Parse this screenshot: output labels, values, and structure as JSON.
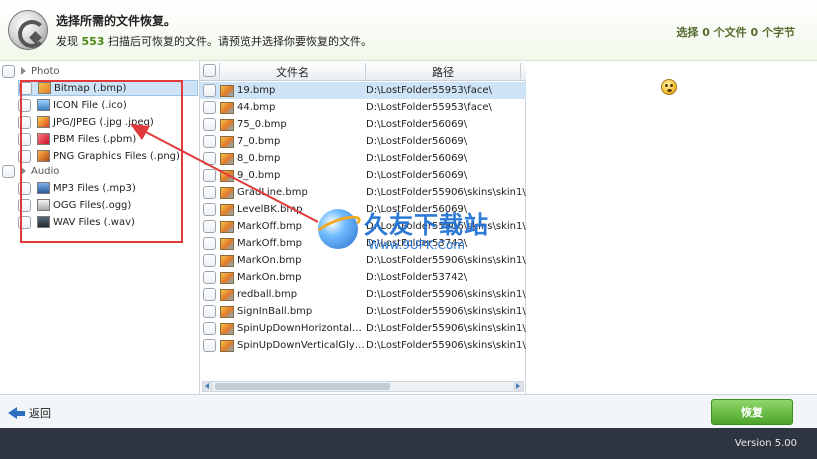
{
  "header": {
    "title": "选择所需的文件恢复。",
    "subtitle_prefix": "发现",
    "found_count": "553",
    "subtitle_suffix": "扫描后可恢复的文件。请预览并选择你要恢复的文件。",
    "selection_summary": "选择 0 个文件 0 个字节"
  },
  "tree": {
    "categories": [
      {
        "label": "Photo",
        "items": [
          {
            "label": "Bitmap (.bmp)",
            "icon": "bitmap-file-icon",
            "selected": true
          },
          {
            "label": "ICON File (.ico)",
            "icon": "icon-file-icon"
          },
          {
            "label": "JPG/JPEG (.jpg .jpeg)",
            "icon": "jpeg-file-icon"
          },
          {
            "label": "PBM Files (.pbm)",
            "icon": "pbm-file-icon"
          },
          {
            "label": "PNG Graphics Files (.png)",
            "icon": "png-file-icon"
          }
        ]
      },
      {
        "label": "Audio",
        "items": [
          {
            "label": "MP3 Files (.mp3)",
            "icon": "mp3-file-icon"
          },
          {
            "label": "OGG Files(.ogg)",
            "icon": "ogg-file-icon"
          },
          {
            "label": "WAV Files (.wav)",
            "icon": "wav-file-icon"
          }
        ]
      }
    ]
  },
  "file_list": {
    "columns": [
      "文件名",
      "路径"
    ],
    "rows": [
      {
        "name": "19.bmp",
        "path": "D:\\LostFolder55953\\face\\",
        "selected": true
      },
      {
        "name": "44.bmp",
        "path": "D:\\LostFolder55953\\face\\"
      },
      {
        "name": "75_0.bmp",
        "path": "D:\\LostFolder56069\\"
      },
      {
        "name": "7_0.bmp",
        "path": "D:\\LostFolder56069\\"
      },
      {
        "name": "8_0.bmp",
        "path": "D:\\LostFolder56069\\"
      },
      {
        "name": "9_0.bmp",
        "path": "D:\\LostFolder56069\\"
      },
      {
        "name": "GradLine.bmp",
        "path": "D:\\LostFolder55906\\skins\\skin1\\"
      },
      {
        "name": "LevelBK.bmp",
        "path": "D:\\LostFolder56069\\"
      },
      {
        "name": "MarkOff.bmp",
        "path": "D:\\LostFolder55906\\skins\\skin1\\"
      },
      {
        "name": "MarkOff.bmp",
        "path": "D:\\LostFolder53742\\"
      },
      {
        "name": "MarkOn.bmp",
        "path": "D:\\LostFolder55906\\skins\\skin1\\"
      },
      {
        "name": "MarkOn.bmp",
        "path": "D:\\LostFolder53742\\"
      },
      {
        "name": "redball.bmp",
        "path": "D:\\LostFolder55906\\skins\\skin1\\"
      },
      {
        "name": "SignInBall.bmp",
        "path": "D:\\LostFolder55906\\skins\\skin1\\"
      },
      {
        "name": "SpinUpDownHorizontalGlyph.b...",
        "path": "D:\\LostFolder55906\\skins\\skin1\\"
      },
      {
        "name": "SpinUpDownVerticalGlyph.bmp",
        "path": "D:\\LostFolder55906\\skins\\skin1\\"
      }
    ]
  },
  "watermark": {
    "title": "久友下载站",
    "url": "Www.9UPK.Com"
  },
  "footer": {
    "back_label": "返回",
    "recover_label": "恢复",
    "version": "Version 5.00"
  },
  "colors": {
    "annotation": "#e23a3a",
    "recover_button": "#4da52a",
    "selection": "#cfe3f7",
    "status_bar": "#2f3540"
  }
}
